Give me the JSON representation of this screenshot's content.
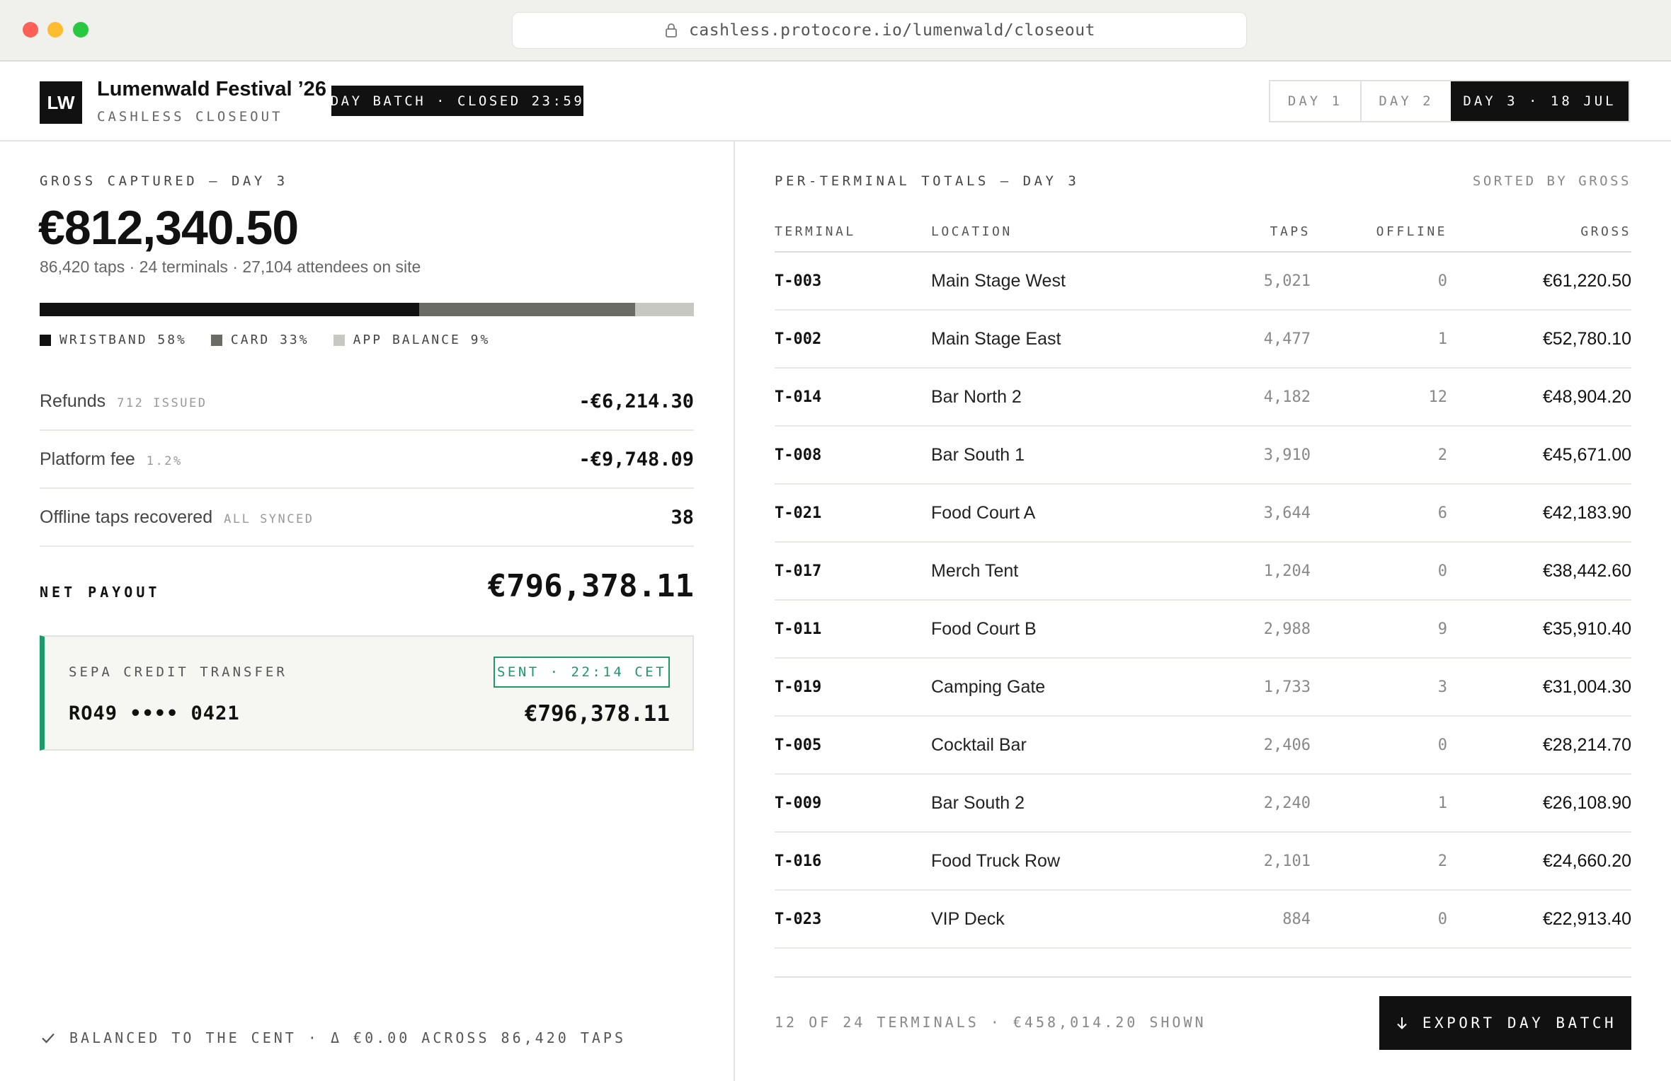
{
  "browser": {
    "url": "cashless.protocore.io/lumenwald/closeout"
  },
  "header": {
    "logo_text": "LW",
    "title": "Lumenwald Festival ’26",
    "subtitle": "CASHLESS CLOSEOUT",
    "batch_badge": "DAY BATCH · CLOSED 23:59",
    "day_tabs": [
      {
        "label": "DAY 1",
        "active": false
      },
      {
        "label": "DAY 2",
        "active": false
      },
      {
        "label": "DAY 3 · 18 JUL",
        "active": true
      }
    ]
  },
  "summary": {
    "gross_label": "GROSS CAPTURED — DAY 3",
    "gross_amount": "€812,340.50",
    "gross_sub": "86,420 taps · 24 terminals · 27,104 attendees on site",
    "mix": [
      {
        "label": "WRISTBAND 58%",
        "fraction": 0.58,
        "color": "#111111"
      },
      {
        "label": "CARD 33%",
        "fraction": 0.33,
        "color": "#6b6b65"
      },
      {
        "label": "APP BALANCE 9%",
        "fraction": 0.09,
        "color": "#c8c8c2"
      }
    ],
    "rows": [
      {
        "label": "Refunds",
        "note": "712 ISSUED",
        "value": "-€6,214.30"
      },
      {
        "label": "Platform fee",
        "note": "1.2%",
        "value": "-€9,748.09"
      },
      {
        "label": "Offline taps recovered",
        "note": "ALL SYNCED",
        "value": "38"
      }
    ],
    "net_label": "NET PAYOUT",
    "net_amount": "€796,378.11"
  },
  "transfer": {
    "label": "SEPA CREDIT TRANSFER",
    "status": "SENT · 22:14 CET",
    "iban": "RO49 •••• 0421",
    "amount": "€796,378.11",
    "accent": "#1d9a6c"
  },
  "balanced_note": "BALANCED TO THE CENT · Δ €0.00 ACROSS 86,420 TAPS",
  "terminals": {
    "title": "PER-TERMINAL TOTALS — DAY 3",
    "sort_note": "SORTED BY GROSS",
    "columns": {
      "terminal": "TERMINAL",
      "location": "LOCATION",
      "taps": "TAPS",
      "offline": "OFFLINE",
      "gross": "GROSS"
    },
    "rows": [
      {
        "terminal": "T-003",
        "location": "Main Stage West",
        "taps": "5,021",
        "offline": "0",
        "gross": "€61,220.50"
      },
      {
        "terminal": "T-002",
        "location": "Main Stage East",
        "taps": "4,477",
        "offline": "1",
        "gross": "€52,780.10"
      },
      {
        "terminal": "T-014",
        "location": "Bar North 2",
        "taps": "4,182",
        "offline": "12",
        "gross": "€48,904.20"
      },
      {
        "terminal": "T-008",
        "location": "Bar South 1",
        "taps": "3,910",
        "offline": "2",
        "gross": "€45,671.00"
      },
      {
        "terminal": "T-021",
        "location": "Food Court A",
        "taps": "3,644",
        "offline": "6",
        "gross": "€42,183.90"
      },
      {
        "terminal": "T-017",
        "location": "Merch Tent",
        "taps": "1,204",
        "offline": "0",
        "gross": "€38,442.60"
      },
      {
        "terminal": "T-011",
        "location": "Food Court B",
        "taps": "2,988",
        "offline": "9",
        "gross": "€35,910.40"
      },
      {
        "terminal": "T-019",
        "location": "Camping Gate",
        "taps": "1,733",
        "offline": "3",
        "gross": "€31,004.30"
      },
      {
        "terminal": "T-005",
        "location": "Cocktail Bar",
        "taps": "2,406",
        "offline": "0",
        "gross": "€28,214.70"
      },
      {
        "terminal": "T-009",
        "location": "Bar South 2",
        "taps": "2,240",
        "offline": "1",
        "gross": "€26,108.90"
      },
      {
        "terminal": "T-016",
        "location": "Food Truck Row",
        "taps": "2,101",
        "offline": "2",
        "gross": "€24,660.20"
      },
      {
        "terminal": "T-023",
        "location": "VIP Deck",
        "taps": "884",
        "offline": "0",
        "gross": "€22,913.40"
      }
    ],
    "footer_note": "12 OF 24 TERMINALS · €458,014.20 SHOWN",
    "export_label": "EXPORT DAY BATCH",
    "export_icon": "arrow-down-icon"
  }
}
